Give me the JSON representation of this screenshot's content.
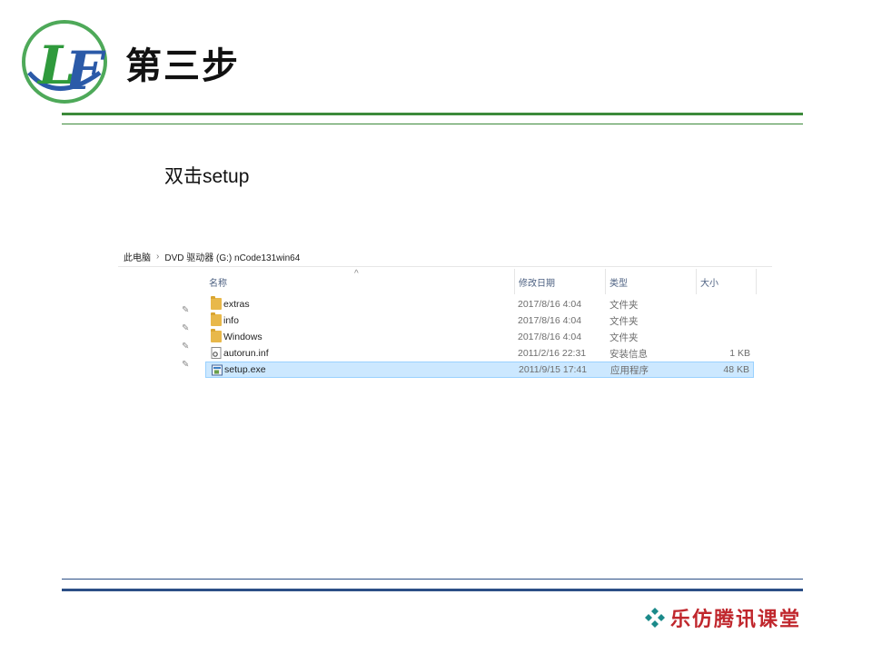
{
  "slide": {
    "title": "第三步",
    "instruction": "双击setup",
    "footer_brand": "乐仿腾讯课堂",
    "logo_letters": "LF"
  },
  "colors": {
    "logo_green": "#2f9a3c",
    "logo_blue": "#2b5aa8",
    "top_rule": "#3c8a3a",
    "bottom_rule": "#2c4f86",
    "brand_red": "#c0272d",
    "diamond_teal": "#1b8a8a",
    "selection": "#cce8ff"
  },
  "explorer": {
    "breadcrumb": [
      "此电脑",
      "DVD 驱动器 (G:) nCode131win64"
    ],
    "columns": {
      "name": "名称",
      "modified": "修改日期",
      "type": "类型",
      "size": "大小"
    },
    "files": [
      {
        "name": "extras",
        "modified": "2017/8/16 4:04",
        "type": "文件夹",
        "size": "",
        "icon": "folder-icon"
      },
      {
        "name": "info",
        "modified": "2017/8/16 4:04",
        "type": "文件夹",
        "size": "",
        "icon": "folder-icon"
      },
      {
        "name": "Windows",
        "modified": "2017/8/16 4:04",
        "type": "文件夹",
        "size": "",
        "icon": "folder-icon"
      },
      {
        "name": "autorun.inf",
        "modified": "2011/2/16 22:31",
        "type": "安装信息",
        "size": "1 KB",
        "icon": "settings-file-icon"
      },
      {
        "name": "setup.exe",
        "modified": "2011/9/15 17:41",
        "type": "应用程序",
        "size": "48 KB",
        "icon": "exe-icon",
        "selected": true
      }
    ]
  }
}
